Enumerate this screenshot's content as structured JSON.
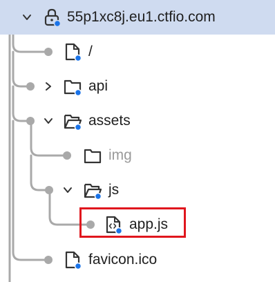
{
  "domain_node": {
    "label": "55p1xc8j.eu1.ctfio.com",
    "icon": "lock-icon"
  },
  "tree_items": [
    {
      "label": "/",
      "icon": "file-icon"
    },
    {
      "label": "api",
      "icon": "folder-icon"
    },
    {
      "label": "assets",
      "icon": "folder-open-icon"
    },
    {
      "label": "img",
      "icon": "folder-icon"
    },
    {
      "label": "js",
      "icon": "folder-open-icon"
    },
    {
      "label": "app.js",
      "icon": "script-file-icon"
    },
    {
      "label": "favicon.ico",
      "icon": "file-icon"
    }
  ],
  "colors": {
    "selected_row": "#cfdbf0",
    "connector": "#a9a9a9",
    "status_dot": "#1a73e8",
    "highlight": "#e0161d",
    "dim_text": "#9a9a9a"
  }
}
